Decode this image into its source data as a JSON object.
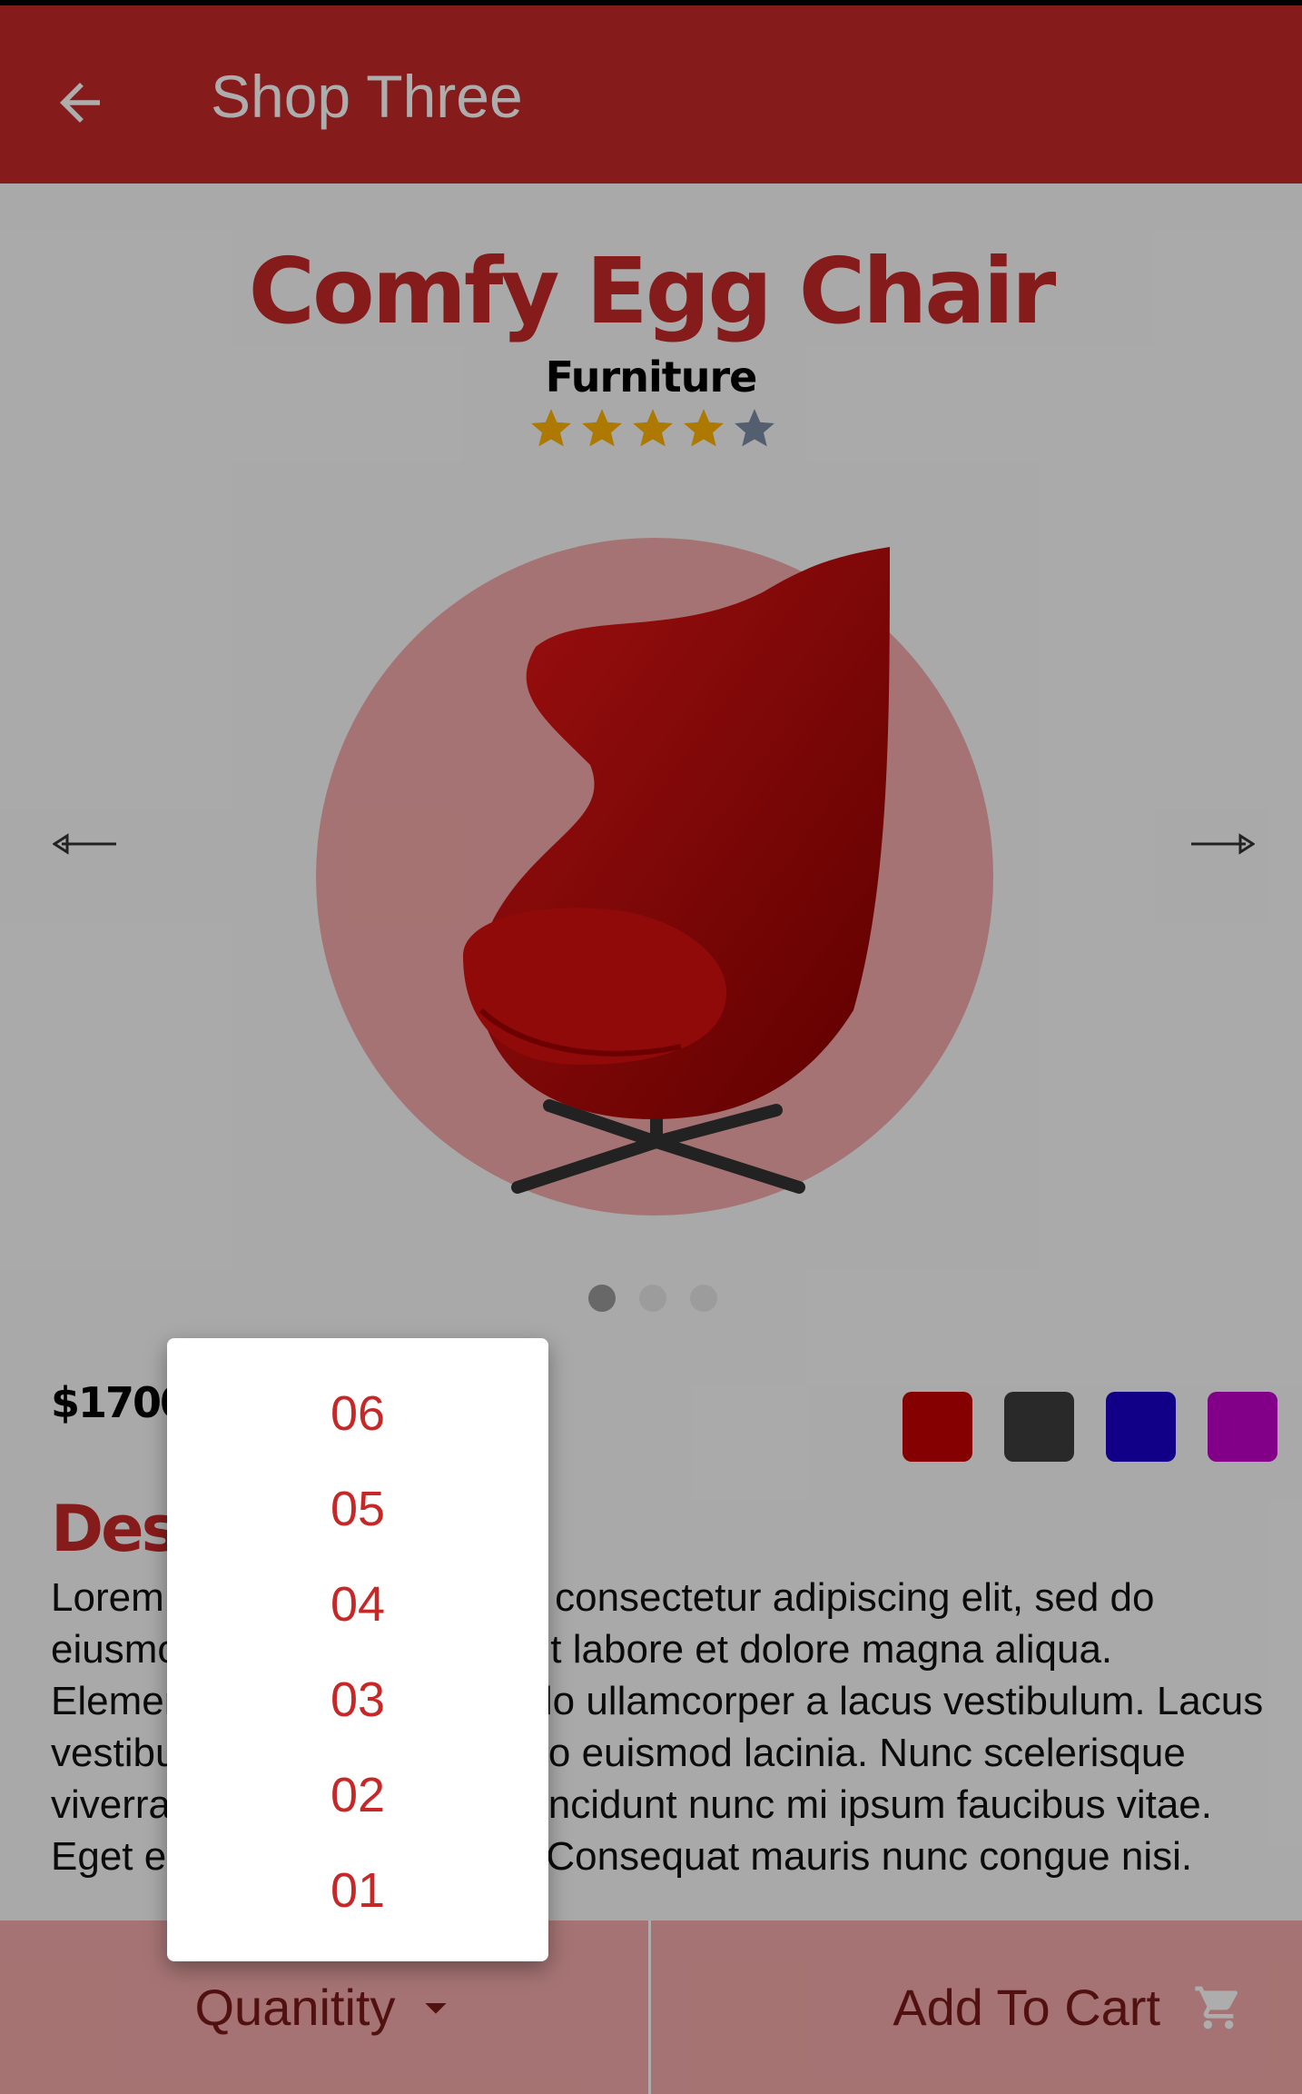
{
  "appbar": {
    "title": "Shop Three",
    "back_icon": "arrow-back-icon"
  },
  "product": {
    "name": "Comfy Egg Chair",
    "category": "Furniture",
    "rating": 4,
    "rating_max": 5,
    "price": "$1700",
    "image": "red-egg-chair",
    "carousel": {
      "slides": 3,
      "active_index": 0
    },
    "colors": [
      "#c50000",
      "#3d3d3d",
      "#1a00c8",
      "#c000c8"
    ]
  },
  "description": {
    "title": "Description",
    "text": "Lorem ipsum dolor sit amet, consectetur adipiscing elit, sed do eiusmod tempor incididunt ut labore et dolore magna aliqua. Elementum tempor commodo ullamcorper a lacus vestibulum. Lacus vestibulum sed arcu non odio euismod lacinia. Nunc scelerisque viverra mauris in aliquam. Tincidunt nunc mi ipsum faucibus vitae. Eget est lorem ipsum dolor. Consequat mauris nunc congue nisi."
  },
  "bottom_bar": {
    "quantity_label": "Quanitity",
    "add_to_cart_label": "Add To Cart"
  },
  "quantity_menu": {
    "options": [
      "06",
      "05",
      "04",
      "03",
      "02",
      "01"
    ]
  },
  "theme": {
    "primary": "#c62828",
    "light": "#f4aaaa"
  }
}
